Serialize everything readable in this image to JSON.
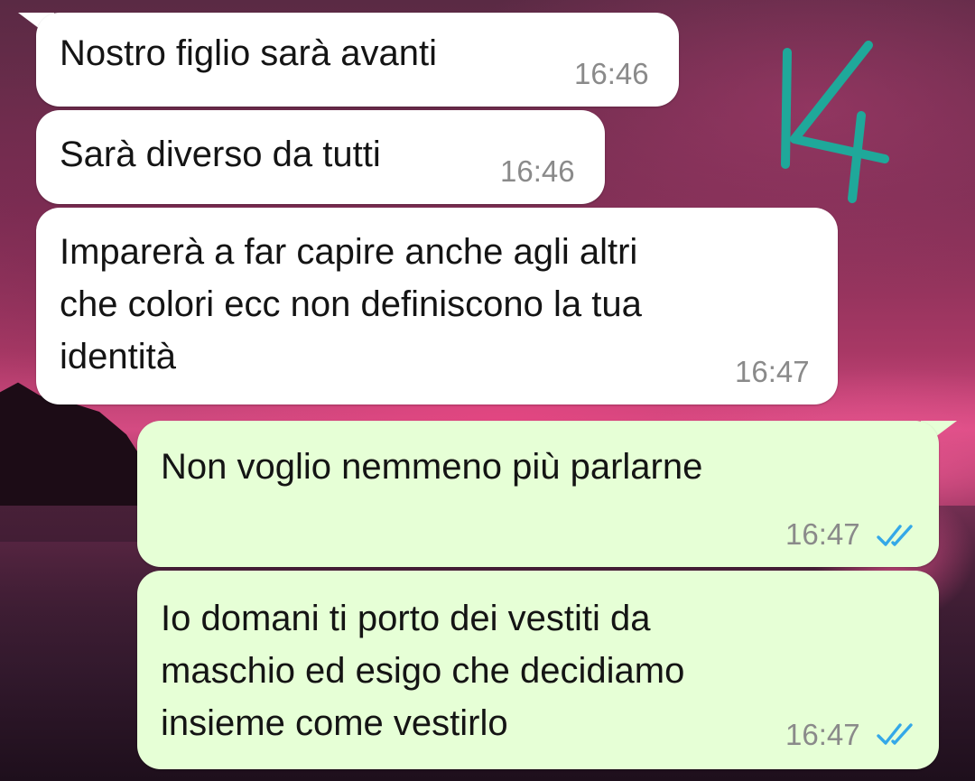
{
  "chat": {
    "messages": [
      {
        "direction": "incoming",
        "text_lines": [
          "Nostro figlio sarà avanti"
        ],
        "time": "16:46"
      },
      {
        "direction": "incoming",
        "text_lines": [
          "Sarà diverso da tutti"
        ],
        "time": "16:46"
      },
      {
        "direction": "incoming",
        "text_lines": [
          "Imparerà a far capire anche agli altri",
          "che colori ecc non definiscono la tua",
          "identità"
        ],
        "time": "16:47"
      },
      {
        "direction": "outgoing",
        "text_lines": [
          "Non voglio nemmeno più parlarne"
        ],
        "time": "16:47",
        "status": "read"
      },
      {
        "direction": "outgoing",
        "text_lines": [
          "Io domani ti porto dei vestiti da",
          "maschio ed esigo che decidiamo",
          "insieme come vestirlo"
        ],
        "time": "16:47",
        "status": "read"
      }
    ]
  },
  "annotation": {
    "text": "14",
    "color": "#1fa89a"
  },
  "icons": {
    "read_receipt": "double-check-icon"
  },
  "colors": {
    "incoming_bubble": "#ffffff",
    "outgoing_bubble": "#e6ffd6",
    "read_tick": "#34a8e8",
    "timestamp": "#8a8a8a"
  }
}
